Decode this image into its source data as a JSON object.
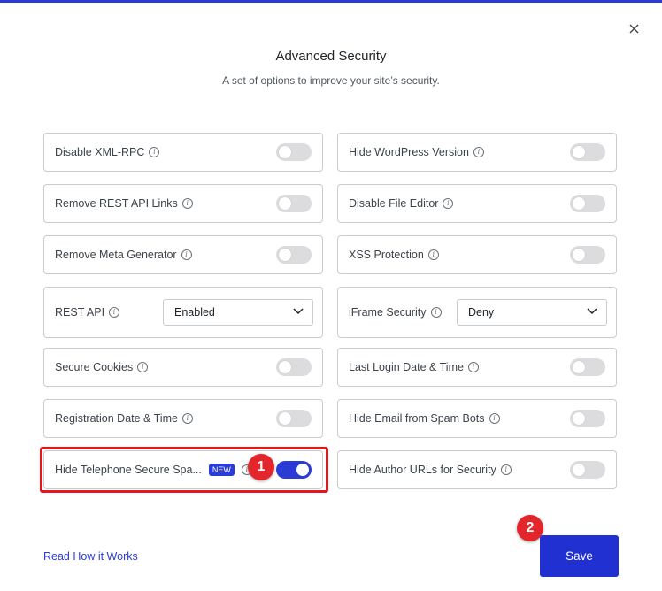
{
  "dialog": {
    "title": "Advanced Security",
    "subtitle": "A set of options to improve your site’s security.",
    "close_icon": "close-icon"
  },
  "settings": {
    "left": [
      {
        "label": "Disable XML-RPC",
        "type": "toggle",
        "on": false
      },
      {
        "label": "Remove REST API Links",
        "type": "toggle",
        "on": false
      },
      {
        "label": "Remove Meta Generator",
        "type": "toggle",
        "on": false
      },
      {
        "label": "REST API",
        "type": "select",
        "value": "Enabled"
      },
      {
        "label": "Secure Cookies",
        "type": "toggle",
        "on": false
      },
      {
        "label": "Registration Date & Time",
        "type": "toggle",
        "on": false
      },
      {
        "label": "Hide Telephone Secure Spa...",
        "type": "toggle",
        "on": true,
        "badge": "NEW"
      }
    ],
    "right": [
      {
        "label": "Hide WordPress Version",
        "type": "toggle",
        "on": false
      },
      {
        "label": "Disable File Editor",
        "type": "toggle",
        "on": false
      },
      {
        "label": "XSS Protection",
        "type": "toggle",
        "on": false
      },
      {
        "label": "iFrame Security",
        "type": "select",
        "value": "Deny"
      },
      {
        "label": "Last Login Date & Time",
        "type": "toggle",
        "on": false
      },
      {
        "label": "Hide Email from Spam Bots",
        "type": "toggle",
        "on": false
      },
      {
        "label": "Hide Author URLs for Security",
        "type": "toggle",
        "on": false
      }
    ]
  },
  "footer": {
    "link_label": "Read How it Works",
    "save_label": "Save"
  },
  "annotations": {
    "marker1": "1",
    "marker2": "2"
  },
  "colors": {
    "accent": "#2b3bd6",
    "toggle_off": "#dcdcde",
    "highlight": "#e3171c"
  }
}
